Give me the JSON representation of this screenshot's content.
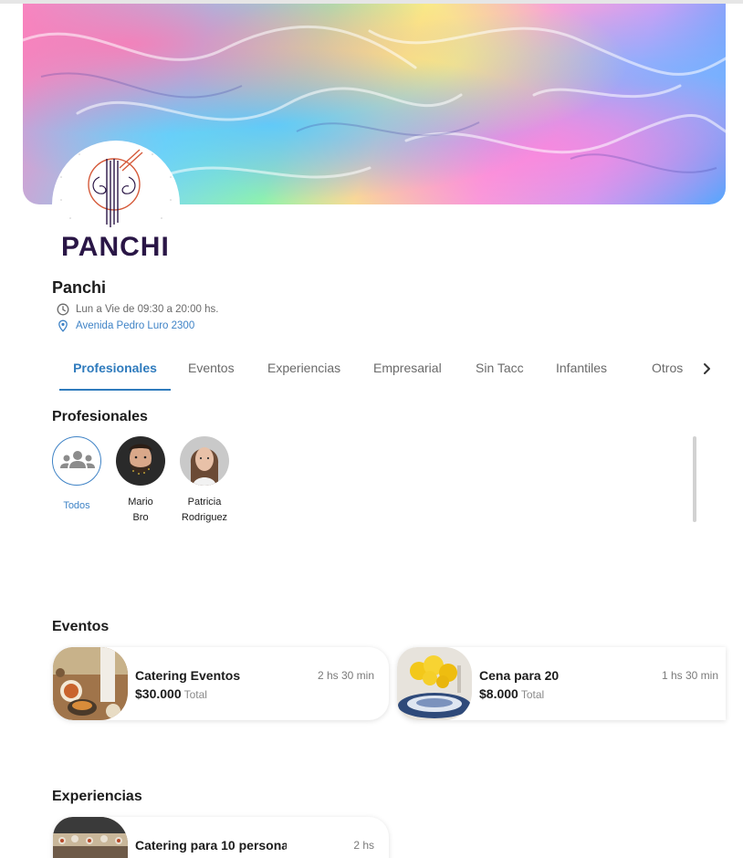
{
  "business": {
    "name": "Panchi",
    "logo_text": "PANCHI",
    "hours": "Lun a Vie de 09:30 a 20:00 hs.",
    "address": "Avenida Pedro Luro 2300"
  },
  "tabs": [
    {
      "label": "Profesionales",
      "active": true
    },
    {
      "label": "Eventos",
      "active": false
    },
    {
      "label": "Experiencias",
      "active": false
    },
    {
      "label": "Empresarial",
      "active": false
    },
    {
      "label": "Sin Tacc",
      "active": false
    },
    {
      "label": "Infantiles",
      "active": false
    },
    {
      "label": "Otros",
      "active": false
    }
  ],
  "profesionales": {
    "title": "Profesionales",
    "items": [
      {
        "name": "Todos",
        "icon": "group-icon"
      },
      {
        "name": "Mario\nBro"
      },
      {
        "name": "Patricia\nRodriguez"
      }
    ]
  },
  "eventos": {
    "title": "Eventos",
    "cards": [
      {
        "title": "Catering Eventos",
        "duration": "2 hs 30 min",
        "price": "$30.000",
        "price_suffix": "Total"
      },
      {
        "title": "Cena para 20",
        "duration": "1 hs 30 min",
        "price": "$8.000",
        "price_suffix": "Total"
      }
    ]
  },
  "experiencias": {
    "title": "Experiencias",
    "cards": [
      {
        "title": "Catering para 10 persona",
        "duration": "2 hs"
      }
    ]
  },
  "colors": {
    "accent": "#2f7bbd",
    "link": "#3f83c6",
    "muted": "#6b6b6b"
  }
}
